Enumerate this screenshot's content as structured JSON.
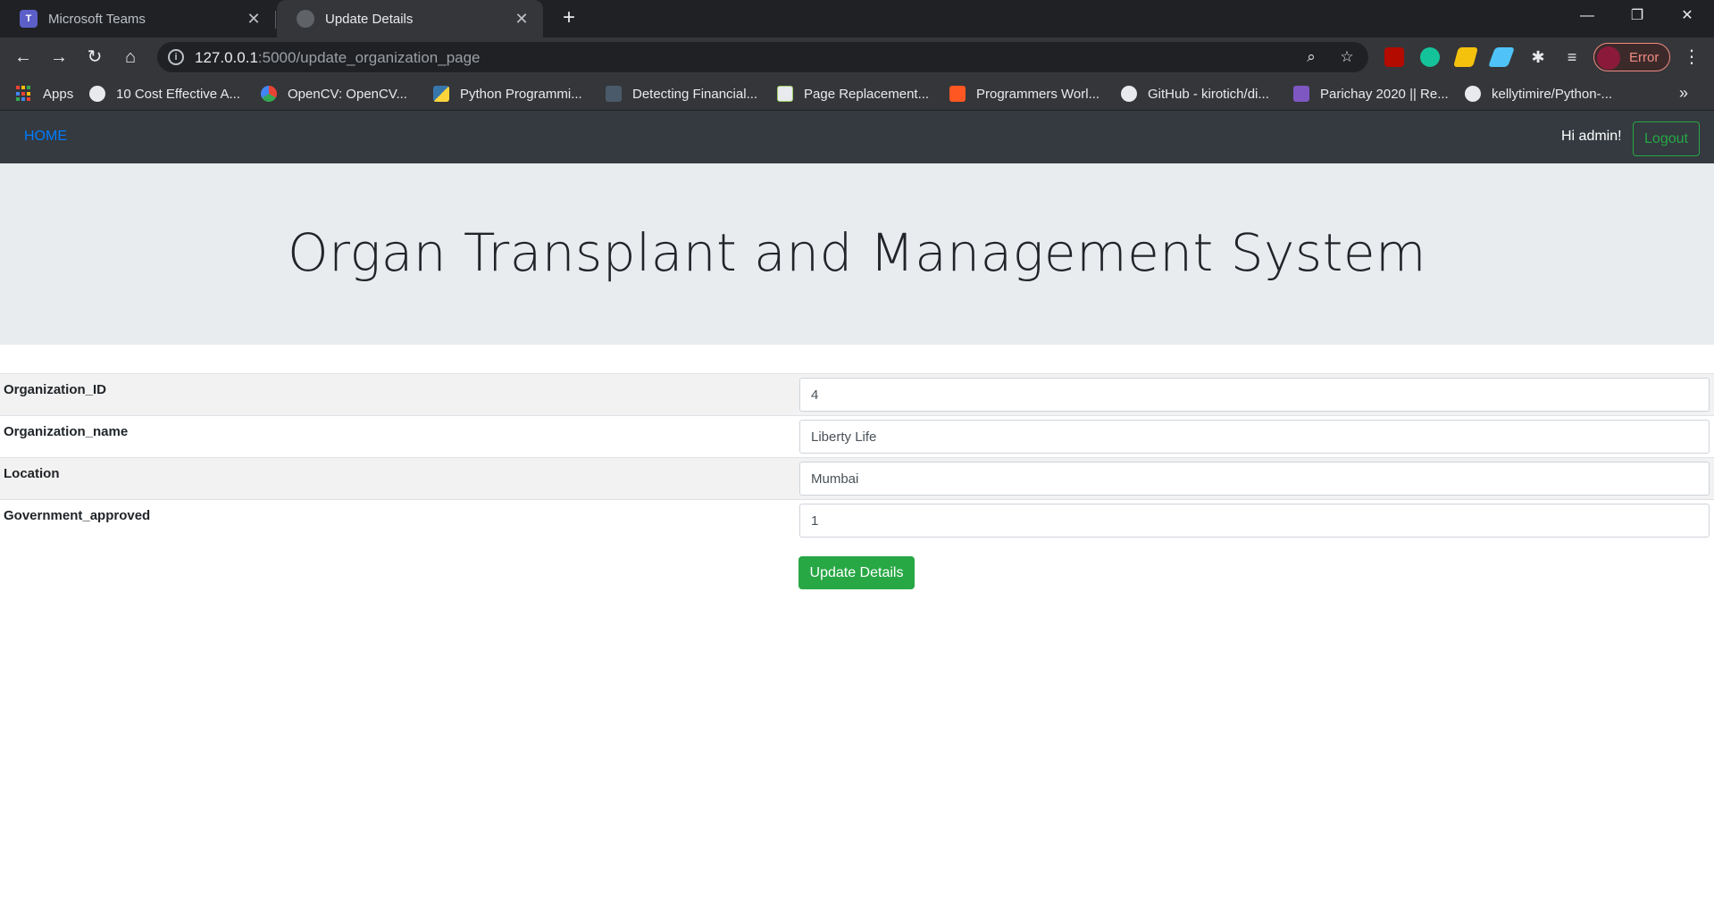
{
  "browser": {
    "tabs": [
      {
        "title": "Microsoft Teams",
        "icon": "teams-icon",
        "active": false
      },
      {
        "title": "Update Details",
        "icon": "globe-icon",
        "active": true
      }
    ],
    "url_host": "127.0.0.1",
    "url_rest": ":5000/update_organization_page",
    "profile_status": "Error",
    "bookmarks": [
      {
        "label": "Apps",
        "icon": "apps-grid-icon"
      },
      {
        "label": "10 Cost Effective A...",
        "icon": "globe-icon"
      },
      {
        "label": "OpenCV: OpenCV...",
        "icon": "opencv-icon"
      },
      {
        "label": "Python Programmi...",
        "icon": "python-icon"
      },
      {
        "label": "Detecting Financial...",
        "icon": "tds-icon"
      },
      {
        "label": "Page Replacement...",
        "icon": "chart-icon"
      },
      {
        "label": "Programmers Worl...",
        "icon": "blogger-icon"
      },
      {
        "label": "GitHub - kirotich/di...",
        "icon": "github-icon"
      },
      {
        "label": "Parichay 2020 || Re...",
        "icon": "forms-icon"
      },
      {
        "label": "kellytimire/Python-...",
        "icon": "github-icon"
      }
    ],
    "bookmarks_more": "»"
  },
  "navbar": {
    "home": "HOME",
    "greeting": "Hi admin!",
    "logout": "Logout"
  },
  "jumbotron": {
    "title": "Organ Transplant and Management System"
  },
  "form": {
    "fields": [
      {
        "label": "Organization_ID",
        "value": "4"
      },
      {
        "label": "Organization_name",
        "value": "Liberty Life"
      },
      {
        "label": "Location",
        "value": "Mumbai"
      },
      {
        "label": "Government_approved",
        "value": "1"
      }
    ],
    "submit": "Update Details"
  },
  "colors": {
    "navbar_bg": "#343a40",
    "jumbotron_bg": "#e9ecef",
    "success": "#28a745",
    "link": "#007bff"
  }
}
